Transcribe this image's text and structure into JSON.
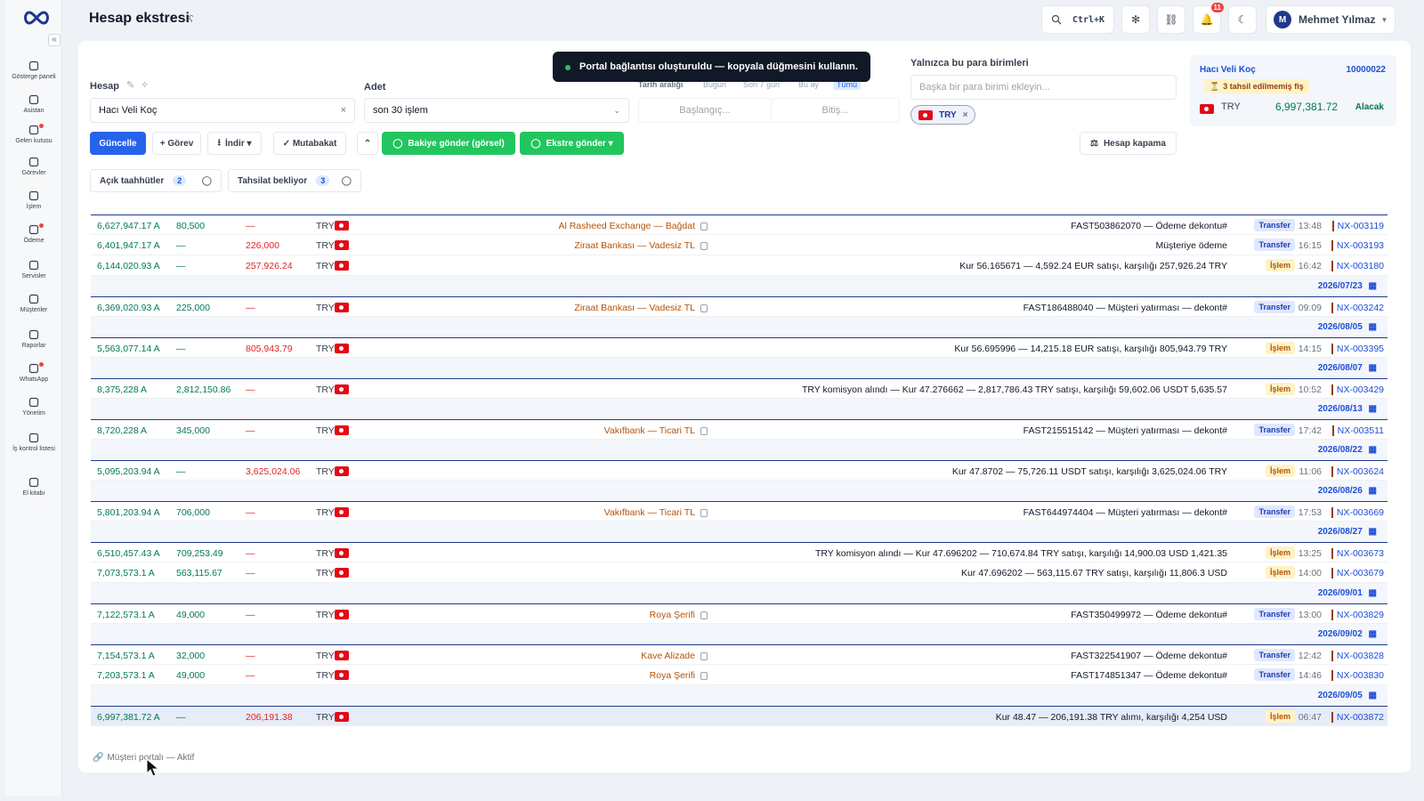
{
  "app": {
    "title": "Hesap ekstresi",
    "brand_color": "#2563eb"
  },
  "nav": [
    {
      "label": "Gösterge paneli",
      "icon": "dashboard-icon"
    },
    {
      "label": "Asistan",
      "icon": "bolt-icon"
    },
    {
      "label": "Gelen kutusu",
      "icon": "inbox-icon"
    },
    {
      "label": "Görevler",
      "icon": "check-icon"
    },
    {
      "label": "İşlem",
      "icon": "arrows-icon"
    },
    {
      "label": "Ödeme",
      "icon": "payment-icon"
    },
    {
      "label": "Servisler",
      "icon": "bolt-icon"
    },
    {
      "label": "Müşteriler",
      "icon": "users-icon"
    },
    {
      "label": "Raporlar",
      "icon": "report-icon"
    },
    {
      "label": "WhatsApp",
      "icon": "whatsapp-icon"
    },
    {
      "label": "Yönetim",
      "icon": "sliders-icon"
    },
    {
      "label": "İş kontrol listesi",
      "icon": "checklist-icon"
    },
    {
      "label": "El kitabı",
      "icon": "book-icon"
    }
  ],
  "topbar": {
    "search_shortcut": "Ctrl+K",
    "notif_count": "11",
    "user_initial": "M",
    "user_name": "Mehmet Yılmaz"
  },
  "filters": {
    "account_label": "Hesap",
    "account_value": "Hacı Veli Koç",
    "count_label": "Adet",
    "count_value": "son 30 işlem",
    "date_label": "Tarih aralığı",
    "date_presets": [
      "Bugün",
      "Son 7 gün",
      "Bu ay",
      "Tümü"
    ],
    "start_placeholder": "Başlangıç...",
    "end_placeholder": "Bitiş...",
    "currency_label": "Yalnızca bu para birimleri",
    "currency_placeholder": "Başka bir para birimi ekleyin...",
    "currency_chip": "TRY"
  },
  "actions": {
    "update": "Güncelle",
    "task": "+ Görev",
    "download": "İndir ▾",
    "reconcile": "✓ Mutabakat",
    "send_balance": "Bakiye gönder (görsel)",
    "send_statement": "Ekstre gönder ▾",
    "close_account": "Hesap kapama"
  },
  "toast": "Portal bağlantısı oluşturuldu — kopyala düğmesini kullanın.",
  "summary": {
    "name": "Hacı Veli Koç",
    "id": "10000022",
    "pending": "3 tahsil edilmemiş fiş",
    "currency": "TRY",
    "balance": "6,997,381.72",
    "side": "Alacak"
  },
  "tabs": [
    {
      "label": "Açık taahhütler",
      "count": "2"
    },
    {
      "label": "Tahsilat bekliyor",
      "count": "3"
    }
  ],
  "rows": [
    {
      "kind": "tx",
      "bal": "6,627,947.17 A",
      "cr": "80,500",
      "db": "—",
      "cur": "TRY",
      "ctp": "Al Rasheed Exchange — Bağdat",
      "desc": "FAST503862070 — Ödeme dekontu#",
      "type": "Transfer",
      "time": "13:48",
      "id": "NX-003119"
    },
    {
      "kind": "tx",
      "bal": "6,401,947.17 A",
      "cr": "—",
      "db": "226,000",
      "cur": "TRY",
      "ctp": "Ziraat Bankası — Vadesiz TL",
      "desc": "Müşteriye ödeme",
      "type": "Transfer",
      "time": "16:15",
      "id": "NX-003193"
    },
    {
      "kind": "tx",
      "bal": "6,144,020.93 A",
      "cr": "—",
      "db": "257,926.24",
      "cur": "TRY",
      "ctp": "",
      "desc": "Kur 56.165671 — 4,592.24 EUR satışı, karşılığı 257,926.24 TRY",
      "type": "İşlem",
      "time": "16:42",
      "id": "NX-003180"
    },
    {
      "kind": "date",
      "date": "2026/07/23"
    },
    {
      "kind": "tx",
      "bal": "6,369,020.93 A",
      "cr": "225,000",
      "db": "—",
      "cur": "TRY",
      "ctp": "Ziraat Bankası — Vadesiz TL",
      "desc": "FAST186488040 — Müşteri yatırması — dekont#",
      "type": "Transfer",
      "time": "09:09",
      "id": "NX-003242"
    },
    {
      "kind": "date",
      "date": "2026/08/05"
    },
    {
      "kind": "tx",
      "bal": "5,563,077.14 A",
      "cr": "—",
      "db": "805,943.79",
      "cur": "TRY",
      "ctp": "",
      "desc": "Kur 56.695996 — 14,215.18 EUR satışı, karşılığı 805,943.79 TRY",
      "type": "İşlem",
      "time": "14:15",
      "id": "NX-003395"
    },
    {
      "kind": "date",
      "date": "2026/08/07"
    },
    {
      "kind": "tx",
      "bal": "8,375,228 A",
      "cr": "2,812,150.86",
      "db": "—",
      "cur": "TRY",
      "ctp": "",
      "desc": "TRY komisyon alındı — Kur 47.276662 — 2,817,786.43 TRY satışı, karşılığı 59,602.06 USDT 5,635.57",
      "type": "İşlem",
      "time": "10:52",
      "id": "NX-003429"
    },
    {
      "kind": "date",
      "date": "2026/08/13"
    },
    {
      "kind": "tx",
      "bal": "8,720,228 A",
      "cr": "345,000",
      "db": "—",
      "cur": "TRY",
      "ctp": "Vakıfbank — Ticari TL",
      "desc": "FAST215515142 — Müşteri yatırması — dekont#",
      "type": "Transfer",
      "time": "17:42",
      "id": "NX-003511"
    },
    {
      "kind": "date",
      "date": "2026/08/22"
    },
    {
      "kind": "tx",
      "bal": "5,095,203.94 A",
      "cr": "—",
      "db": "3,625,024.06",
      "cur": "TRY",
      "ctp": "",
      "desc": "Kur 47.8702 — 75,726.11 USDT satışı, karşılığı 3,625,024.06 TRY",
      "type": "İşlem",
      "time": "11:06",
      "id": "NX-003624"
    },
    {
      "kind": "date",
      "date": "2026/08/26"
    },
    {
      "kind": "tx",
      "bal": "5,801,203.94 A",
      "cr": "706,000",
      "db": "—",
      "cur": "TRY",
      "ctp": "Vakıfbank — Ticari TL",
      "desc": "FAST644974404 — Müşteri yatırması — dekont#",
      "type": "Transfer",
      "time": "17:53",
      "id": "NX-003669"
    },
    {
      "kind": "date",
      "date": "2026/08/27"
    },
    {
      "kind": "tx",
      "bal": "6,510,457.43 A",
      "cr": "709,253.49",
      "db": "—",
      "cur": "TRY",
      "ctp": "",
      "desc": "TRY komisyon alındı — Kur 47.696202 — 710,674.84 TRY satışı, karşılığı 14,900.03 USD 1,421.35",
      "type": "İşlem",
      "time": "13:25",
      "id": "NX-003673"
    },
    {
      "kind": "tx",
      "bal": "7,073,573.1 A",
      "cr": "563,115.67",
      "db": "—",
      "cur": "TRY",
      "ctp": "",
      "desc": "Kur 47.696202 — 563,115.67 TRY satışı, karşılığı 11,806.3 USD",
      "type": "İşlem",
      "time": "14:00",
      "id": "NX-003679"
    },
    {
      "kind": "date",
      "date": "2026/09/01"
    },
    {
      "kind": "tx",
      "bal": "7,122,573.1 A",
      "cr": "49,000",
      "db": "—",
      "cur": "TRY",
      "ctp": "Roya Şerifi",
      "desc": "FAST350499972 — Ödeme dekontu#",
      "type": "Transfer",
      "time": "13:00",
      "id": "NX-003829"
    },
    {
      "kind": "date",
      "date": "2026/09/02"
    },
    {
      "kind": "tx",
      "bal": "7,154,573.1 A",
      "cr": "32,000",
      "db": "—",
      "cur": "TRY",
      "ctp": "Kave Alizade",
      "desc": "FAST322541907 — Ödeme dekontu#",
      "type": "Transfer",
      "time": "12:42",
      "id": "NX-003828"
    },
    {
      "kind": "tx",
      "bal": "7,203,573.1 A",
      "cr": "49,000",
      "db": "—",
      "cur": "TRY",
      "ctp": "Roya Şerifi",
      "desc": "FAST174851347 — Ödeme dekontu#",
      "type": "Transfer",
      "time": "14:46",
      "id": "NX-003830"
    },
    {
      "kind": "date",
      "date": "2026/09/05"
    },
    {
      "kind": "tx",
      "bal": "6,997,381.72 A",
      "cr": "—",
      "db": "206,191.38",
      "cur": "TRY",
      "ctp": "",
      "desc": "Kur 48.47 — 206,191.38 TRY alımı, karşılığı 4,254 USD",
      "type": "İşlem",
      "time": "06:47",
      "id": "NX-003872",
      "highlight": true
    }
  ],
  "footer": "Müşteri portalı — Aktif"
}
